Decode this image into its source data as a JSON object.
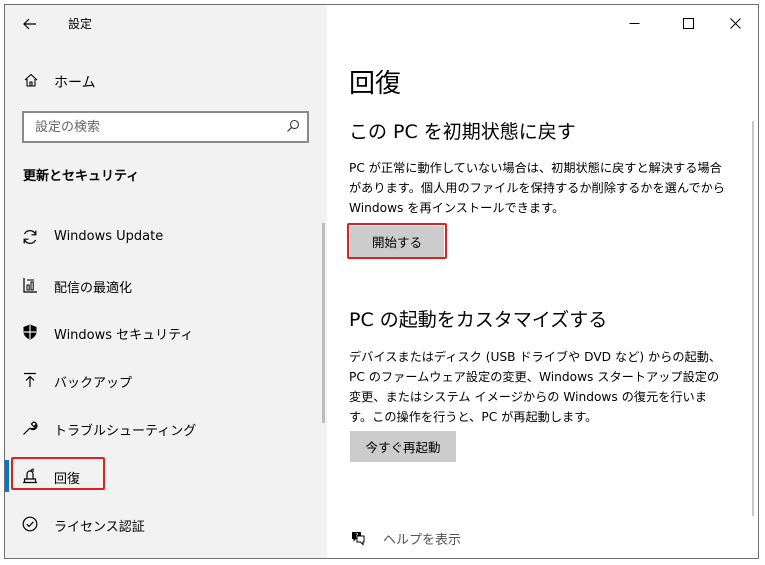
{
  "app": {
    "title": "設定"
  },
  "sidebar": {
    "home_label": "ホーム",
    "search_placeholder": "設定の検索",
    "section_title": "更新とセキュリティ",
    "items": [
      {
        "label": "Windows Update",
        "icon": "sync-icon"
      },
      {
        "label": "配信の最適化",
        "icon": "delivery-optimization-icon"
      },
      {
        "label": "Windows セキュリティ",
        "icon": "shield-icon"
      },
      {
        "label": "バックアップ",
        "icon": "backup-arrow-icon"
      },
      {
        "label": "トラブルシューティング",
        "icon": "wrench-icon"
      },
      {
        "label": "回復",
        "icon": "recovery-icon",
        "selected": true
      },
      {
        "label": "ライセンス認証",
        "icon": "check-circle-icon"
      }
    ]
  },
  "main": {
    "title": "回復",
    "reset": {
      "heading": "この PC を初期状態に戻す",
      "description": "PC が正常に動作していない場合は、初期状態に戻すと解決する場合があります。個人用のファイルを保持するか削除するかを選んでから Windows を再インストールできます。",
      "button": "開始する"
    },
    "advanced": {
      "heading": "PC の起動をカスタマイズする",
      "description": "デバイスまたはディスク (USB ドライブや DVD など) からの起動、PC のファームウェア設定の変更、Windows スタートアップ設定の変更、またはシステム イメージからの Windows の復元を行います。この操作を行うと、PC が再起動します。",
      "button": "今すぐ再起動"
    },
    "help_label": "ヘルプを表示"
  },
  "colors": {
    "accent": "#0078d4",
    "highlight": "#e02020",
    "sidebar_bg": "#f2f2f2",
    "button_bg": "#cccccc"
  }
}
